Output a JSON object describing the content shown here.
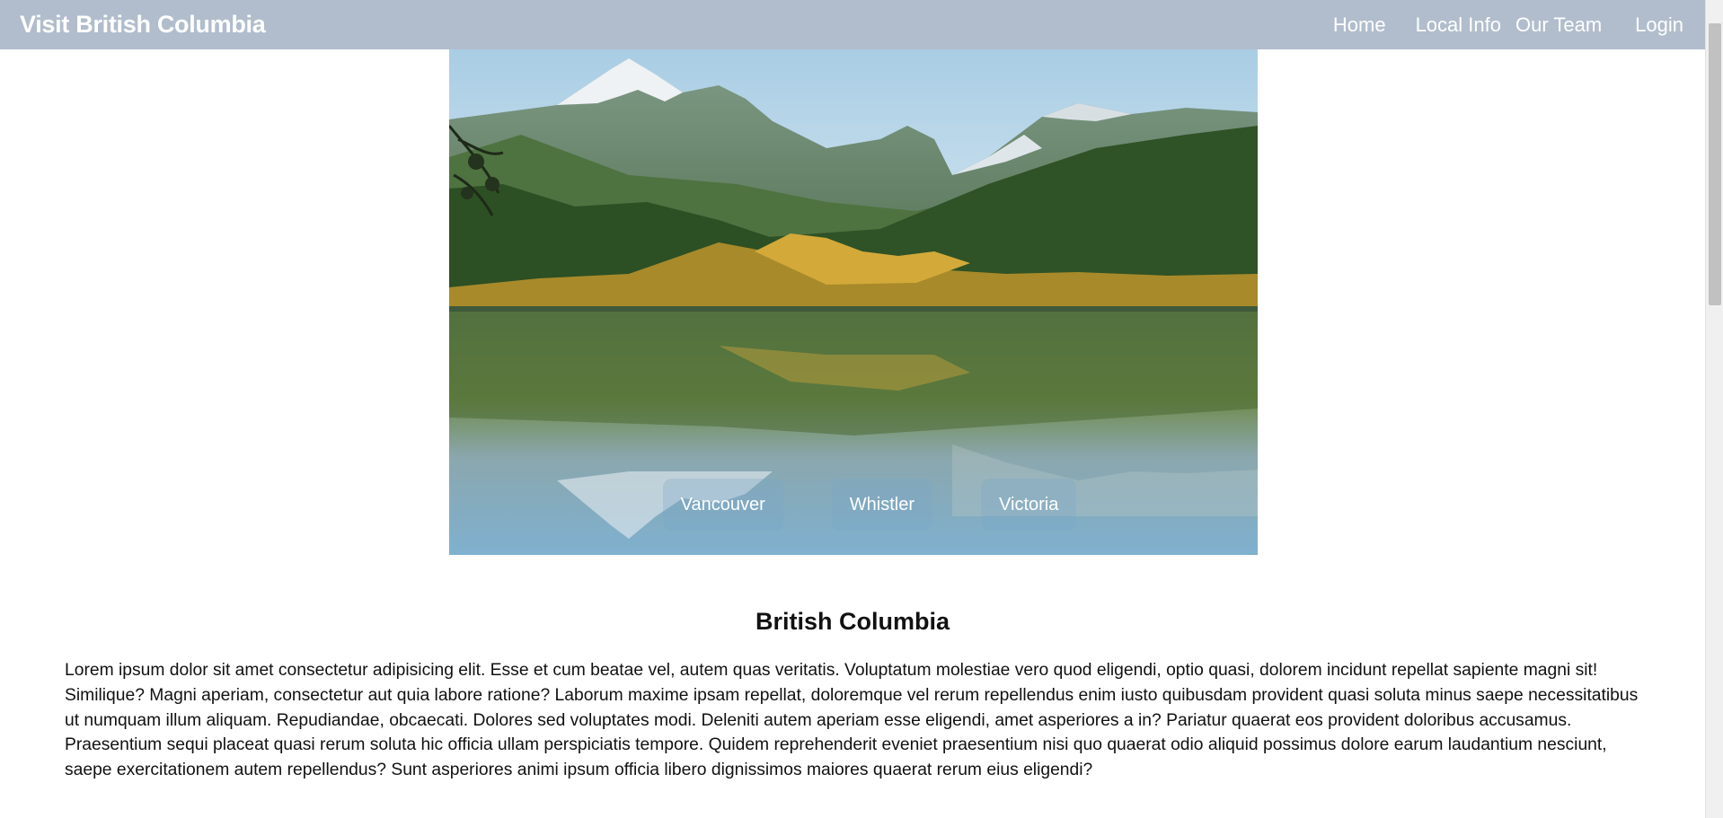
{
  "navbar": {
    "brand": "Visit British Columbia",
    "links": [
      "Home",
      "Local Info",
      "Our Team",
      "Login"
    ]
  },
  "hero": {
    "cities": [
      "Vancouver",
      "Whistler",
      "Victoria"
    ]
  },
  "content": {
    "title": "British Columbia",
    "body": "Lorem ipsum dolor sit amet consectetur adipisicing elit. Esse et cum beatae vel, autem quas veritatis. Voluptatum molestiae vero quod eligendi, optio quasi, dolorem incidunt repellat sapiente magni sit! Similique? Magni aperiam, consectetur aut quia labore ratione? Laborum maxime ipsam repellat, doloremque vel rerum repellendus enim iusto quibusdam provident quasi soluta minus saepe necessitatibus ut numquam illum aliquam. Repudiandae, obcaecati. Dolores sed voluptates modi. Deleniti autem aperiam esse eligendi, amet asperiores a in? Pariatur quaerat eos provident doloribus accusamus. Praesentium sequi placeat quasi rerum soluta hic officia ullam perspiciatis tempore. Quidem reprehenderit eveniet praesentium nisi quo quaerat odio aliquid possimus dolore earum laudantium nesciunt, saepe exercitationem autem repellendus? Sunt asperiores animi ipsum officia libero dignissimos maiores quaerat rerum eius eligendi?"
  },
  "colors": {
    "navbar_bg": "#b1bdcc",
    "nav_text": "#ffffff",
    "body_text": "#111111"
  }
}
